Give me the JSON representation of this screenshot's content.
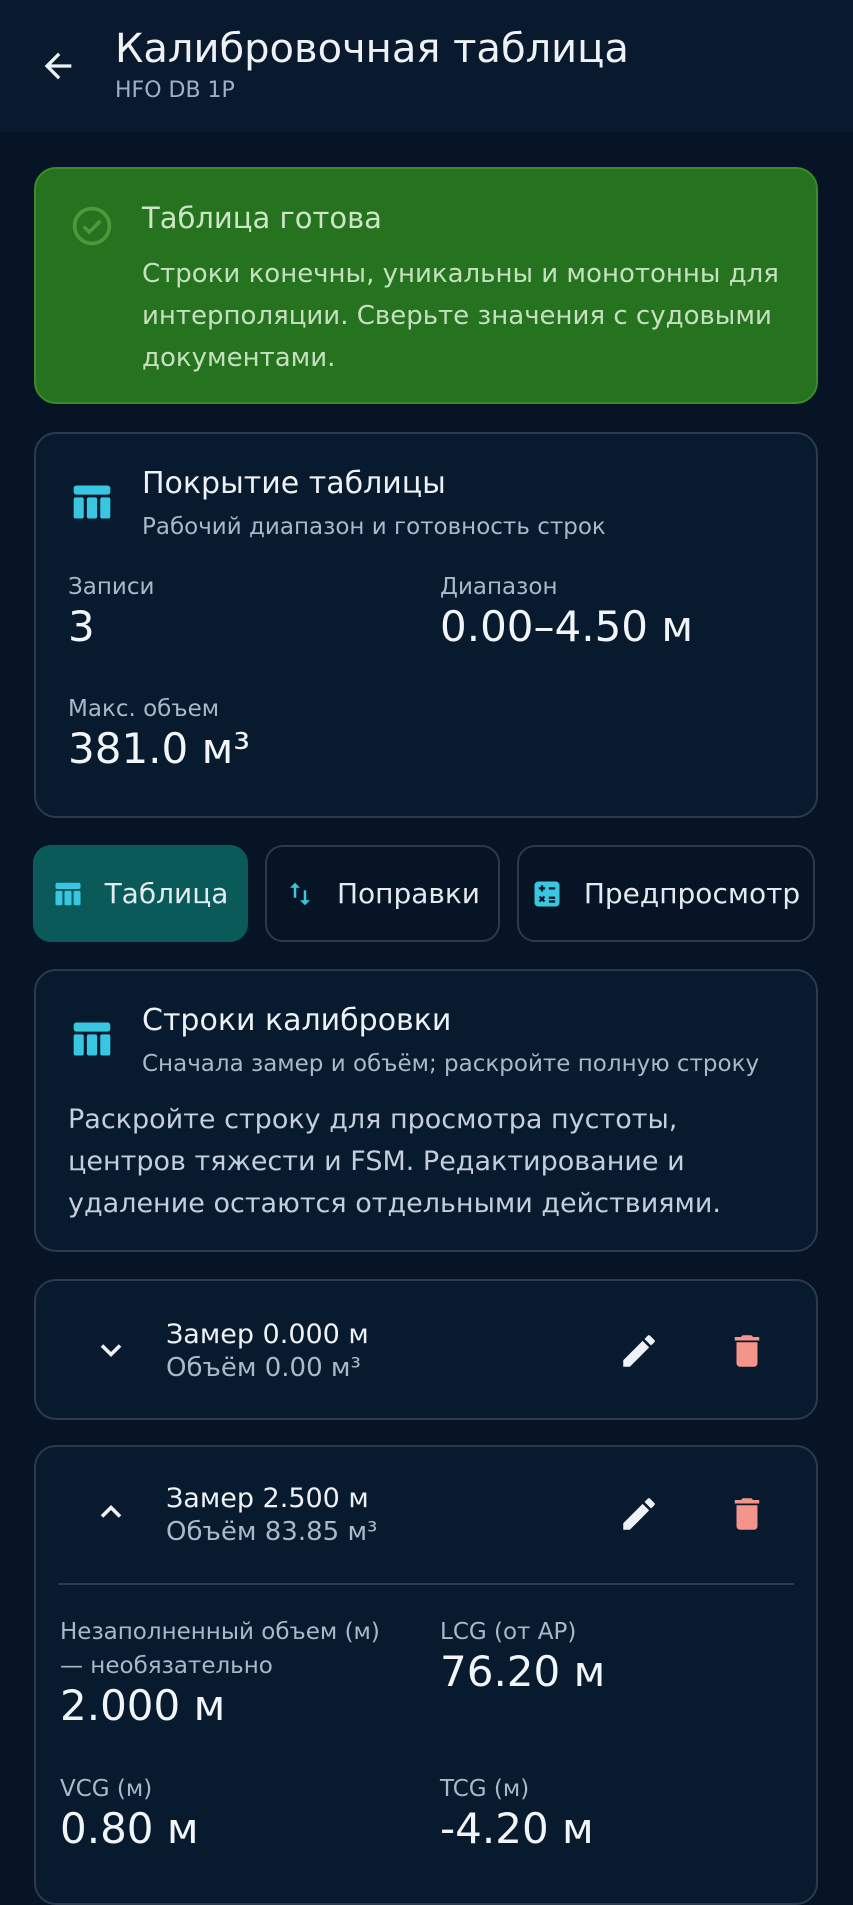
{
  "appbar": {
    "title": "Калибровочная таблица",
    "subtitle": "HFO DB 1P",
    "back_icon": "arrow-left-icon"
  },
  "ready_banner": {
    "title": "Таблица готова",
    "text": "Строки конечны, уникальны и монотонны для интерполяции. Сверьте значения с судовыми документами.",
    "icon": "check-circle-icon",
    "color": "#25721f"
  },
  "coverage": {
    "title": "Покрытие таблицы",
    "subtitle": "Рабочий диапазон и готовность строк",
    "records_label": "Записи",
    "records_value": "3",
    "range_label": "Диапазон",
    "range_value": "0.00–4.50 м",
    "max_volume_label": "Макс. объем",
    "max_volume_value": "381.0 м³",
    "icon": "table-icon"
  },
  "tabs": [
    {
      "label": "Таблица",
      "icon": "table-icon",
      "active": true
    },
    {
      "label": "Поправки",
      "icon": "sort-arrows-icon",
      "active": false
    },
    {
      "label": "Предпросмотр",
      "icon": "calculator-icon",
      "active": false
    }
  ],
  "rows_section": {
    "title": "Строки калибровки",
    "subtitle": "Сначала замер и объём; раскройте полную строку",
    "text": "Раскройте строку для просмотра пустоты, центров тяжести и FSM. Редактирование и удаление остаются отдельными действиями."
  },
  "rows": [
    {
      "title": "Замер 0.000 м",
      "subtitle": "Объём 0.00 м³",
      "expanded": false
    },
    {
      "title": "Замер 2.500 м",
      "subtitle": "Объём 83.85 м³",
      "expanded": true,
      "details": {
        "ullage_label": "Незаполненный объем (м) — необязательно",
        "ullage_value": "2.000 м",
        "lcg_label": "LCG (от AP)",
        "lcg_value": "76.20 м",
        "vcg_label": "VCG (м)",
        "vcg_value": "0.80 м",
        "tcg_label": "TCG (м)",
        "tcg_value": "-4.20 м"
      }
    }
  ],
  "colors": {
    "background": "#061425",
    "accent": "#0b5a5a",
    "icon_accent": "#39c6e0",
    "delete": "#f4948a"
  }
}
